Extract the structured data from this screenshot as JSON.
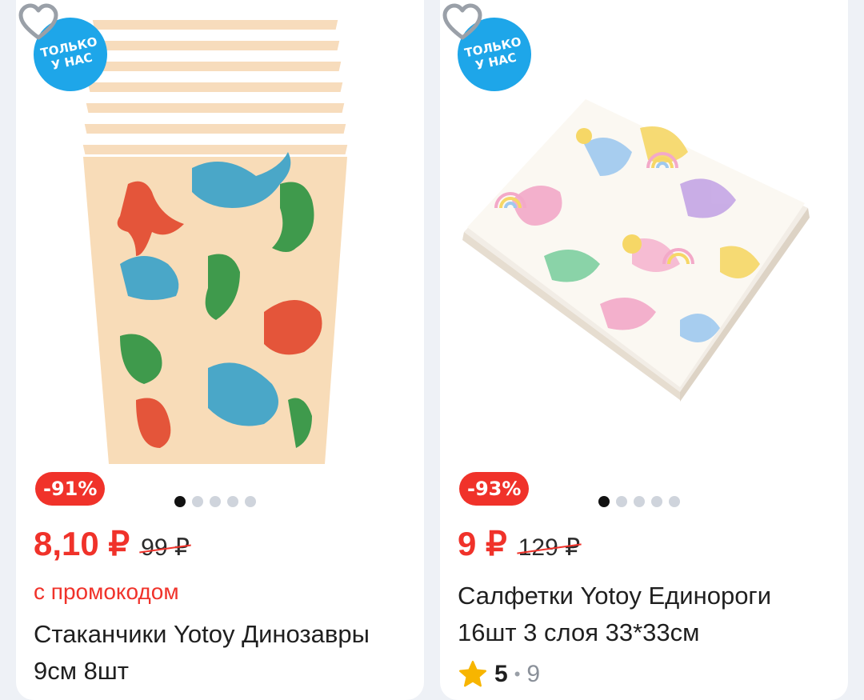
{
  "products": [
    {
      "badge": "ТОЛЬКО\nУ НАС",
      "discount": "-91%",
      "price": "8,10 ₽",
      "old_price": "99 ₽",
      "promo": "с промокодом",
      "title": "Стаканчики Yotoy Динозавры 9см 8шт",
      "active_dot": 0,
      "dot_count": 5,
      "image_icon": "paper-cups-dinosaurs-image"
    },
    {
      "badge": "ТОЛЬКО\nУ НАС",
      "discount": "-93%",
      "price": "9 ₽",
      "old_price": "129 ₽",
      "title": "Салфетки Yotoy Единороги 16шт 3 слоя 33*33см",
      "rating": "5",
      "rating_separator": "•",
      "reviews": "9",
      "active_dot": 0,
      "dot_count": 5,
      "image_icon": "napkins-unicorns-image"
    }
  ],
  "colors": {
    "accent_red": "#f0322a",
    "badge_blue": "#1ea6e9",
    "star_yellow": "#f7b500"
  }
}
